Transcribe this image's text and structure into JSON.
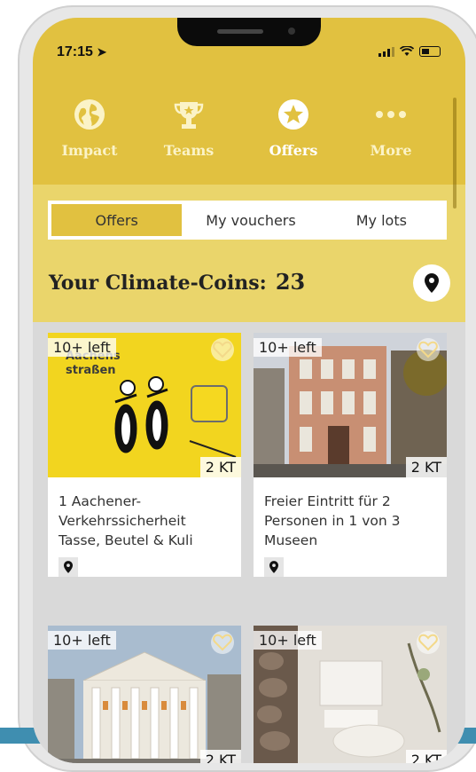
{
  "status": {
    "time": "17:15"
  },
  "nav": {
    "items": [
      {
        "label": "Impact",
        "icon": "globe-icon"
      },
      {
        "label": "Teams",
        "icon": "trophy-icon"
      },
      {
        "label": "Offers",
        "icon": "star-icon"
      },
      {
        "label": "More",
        "icon": "more-dots-icon"
      }
    ],
    "active": "Offers"
  },
  "tabs": [
    {
      "label": "Offers",
      "active": true
    },
    {
      "label": "My vouchers",
      "active": false
    },
    {
      "label": "My lots",
      "active": false
    }
  ],
  "coins": {
    "label": "Your Climate-Coins:",
    "value": "23"
  },
  "offers": [
    {
      "badge": "10+ left",
      "price": "2 KT",
      "title": "1 Aachener-Verkehrssicherheit Tasse, Beutel & Kuli",
      "image_text": "Aachens straßen"
    },
    {
      "badge": "10+ left",
      "price": "2 KT",
      "title": "Freier Eintritt für 2 Personen in 1 von 3 Museen"
    },
    {
      "badge": "10+ left",
      "price": "2 KT"
    },
    {
      "badge": "10+ left",
      "price": "2 KT"
    }
  ],
  "colors": {
    "primary": "#e1c140",
    "header": "#ead56b",
    "background": "#d9d9d9"
  }
}
